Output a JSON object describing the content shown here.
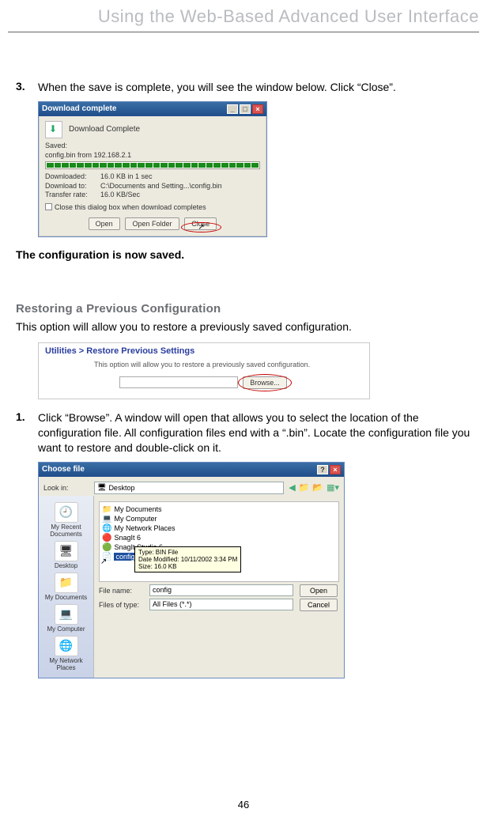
{
  "header": {
    "title": "Using the Web-Based Advanced User Interface"
  },
  "step3": {
    "num": "3.",
    "text": "When the save is complete, you will see the window below. Click “Close”."
  },
  "download_dialog": {
    "title": "Download complete",
    "title2": "Download Complete",
    "saved_label": "Saved:",
    "saved_path": "config.bin from 192.168.2.1",
    "downloaded_label": "Downloaded:",
    "downloaded_val": "16.0 KB in 1 sec",
    "download_to_label": "Download to:",
    "download_to_val": "C:\\Documents and Setting...\\config.bin",
    "transfer_label": "Transfer rate:",
    "transfer_val": "16.0 KB/Sec",
    "checkbox_label": "Close this dialog box when download completes",
    "btn_open": "Open",
    "btn_open_folder": "Open Folder",
    "btn_close": "Close"
  },
  "statement": "The configuration is now saved.",
  "section": {
    "heading": "Restoring a Previous Configuration",
    "desc": "This option will allow you to restore a previously saved configuration."
  },
  "restore_panel": {
    "breadcrumb_prefix": "Utilities > ",
    "breadcrumb_bold": "Restore Previous Settings",
    "desc": "This option will allow you to restore a previously saved configuration.",
    "browse_btn": "Browse..."
  },
  "step1": {
    "num": "1.",
    "text": "Click “Browse”. A window will open that allows you to select the location of the configuration file. All configuration files end with a “.bin”. Locate the configuration file you want to restore and double-click on it."
  },
  "choose_dialog": {
    "title": "Choose file",
    "look_in_label": "Look in:",
    "look_in_value": "Desktop",
    "sidebar": {
      "recent": "My Recent Documents",
      "desktop": "Desktop",
      "mydocs": "My Documents",
      "mycomp": "My Computer",
      "myplaces": "My Network Places"
    },
    "files": {
      "mydocs": "My Documents",
      "mycomp": "My Computer",
      "myplaces": "My Network Places",
      "snagit": "SnagIt 6",
      "snagit_studio": "SnagIt Studio 6",
      "config": "config"
    },
    "tooltip": {
      "type": "Type: BIN File",
      "modified": "Date Modified: 10/11/2002 3:34 PM",
      "size": "Size: 16.0 KB"
    },
    "filename_label": "File name:",
    "filename_value": "config",
    "filetype_label": "Files of type:",
    "filetype_value": "All Files (*.*)",
    "btn_open": "Open",
    "btn_cancel": "Cancel"
  },
  "page_number": "46"
}
